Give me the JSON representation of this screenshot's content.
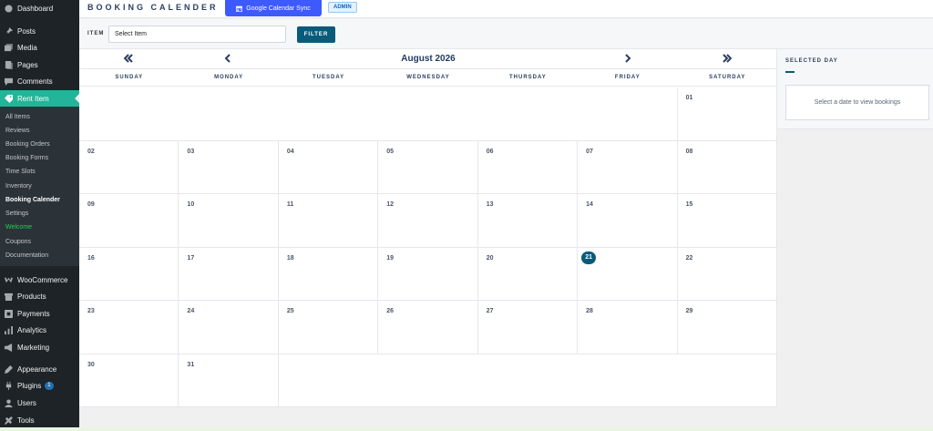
{
  "sidebar": {
    "items": [
      {
        "label": "Dashboard",
        "icon": "dashboard-icon",
        "top": 0
      },
      {
        "label": "Posts",
        "icon": "pin-icon"
      },
      {
        "label": "Media",
        "icon": "media-icon"
      },
      {
        "label": "Pages",
        "icon": "pages-icon"
      },
      {
        "label": "Comments",
        "icon": "comments-icon"
      },
      {
        "label": "Rent Item",
        "icon": "tag-icon"
      },
      {
        "label": "WooCommerce",
        "icon": "woo-icon"
      },
      {
        "label": "Products",
        "icon": "products-icon"
      },
      {
        "label": "Payments",
        "icon": "payments-icon"
      },
      {
        "label": "Analytics",
        "icon": "analytics-icon"
      },
      {
        "label": "Marketing",
        "icon": "marketing-icon"
      },
      {
        "label": "Appearance",
        "icon": "appearance-icon"
      },
      {
        "label": "Plugins",
        "icon": "plugins-icon",
        "badge": "1"
      },
      {
        "label": "Users",
        "icon": "users-icon"
      },
      {
        "label": "Tools",
        "icon": "tools-icon"
      }
    ],
    "submenu": [
      "All Items",
      "Reviews",
      "Booking Orders",
      "Booking Forms",
      "Time Slots",
      "Inventory",
      "Booking Calender",
      "Settings",
      "Welcome",
      "Coupons",
      "Documentation"
    ]
  },
  "header": {
    "title": "BOOKING CALENDER",
    "gcal_label": "Google Calendar Sync",
    "admin_badge": "ADMIN"
  },
  "filter": {
    "item_label": "ITEM",
    "select_value": "Select Item",
    "filter_label": "FILTER"
  },
  "calendar": {
    "month": "August 2026",
    "weekdays": [
      "SUNDAY",
      "MONDAY",
      "TUESDAY",
      "WEDNESDAY",
      "THURSDAY",
      "FRIDAY",
      "SATURDAY"
    ],
    "first_weekday": 6,
    "days_in_month": 31,
    "today": "21",
    "colors": {
      "accent": "#0a5a7a",
      "active_menu": "#23b499",
      "sync_button": "#3d5afe"
    }
  },
  "panel": {
    "title": "SELECTED DAY",
    "empty_text": "Select a date to view bookings"
  }
}
